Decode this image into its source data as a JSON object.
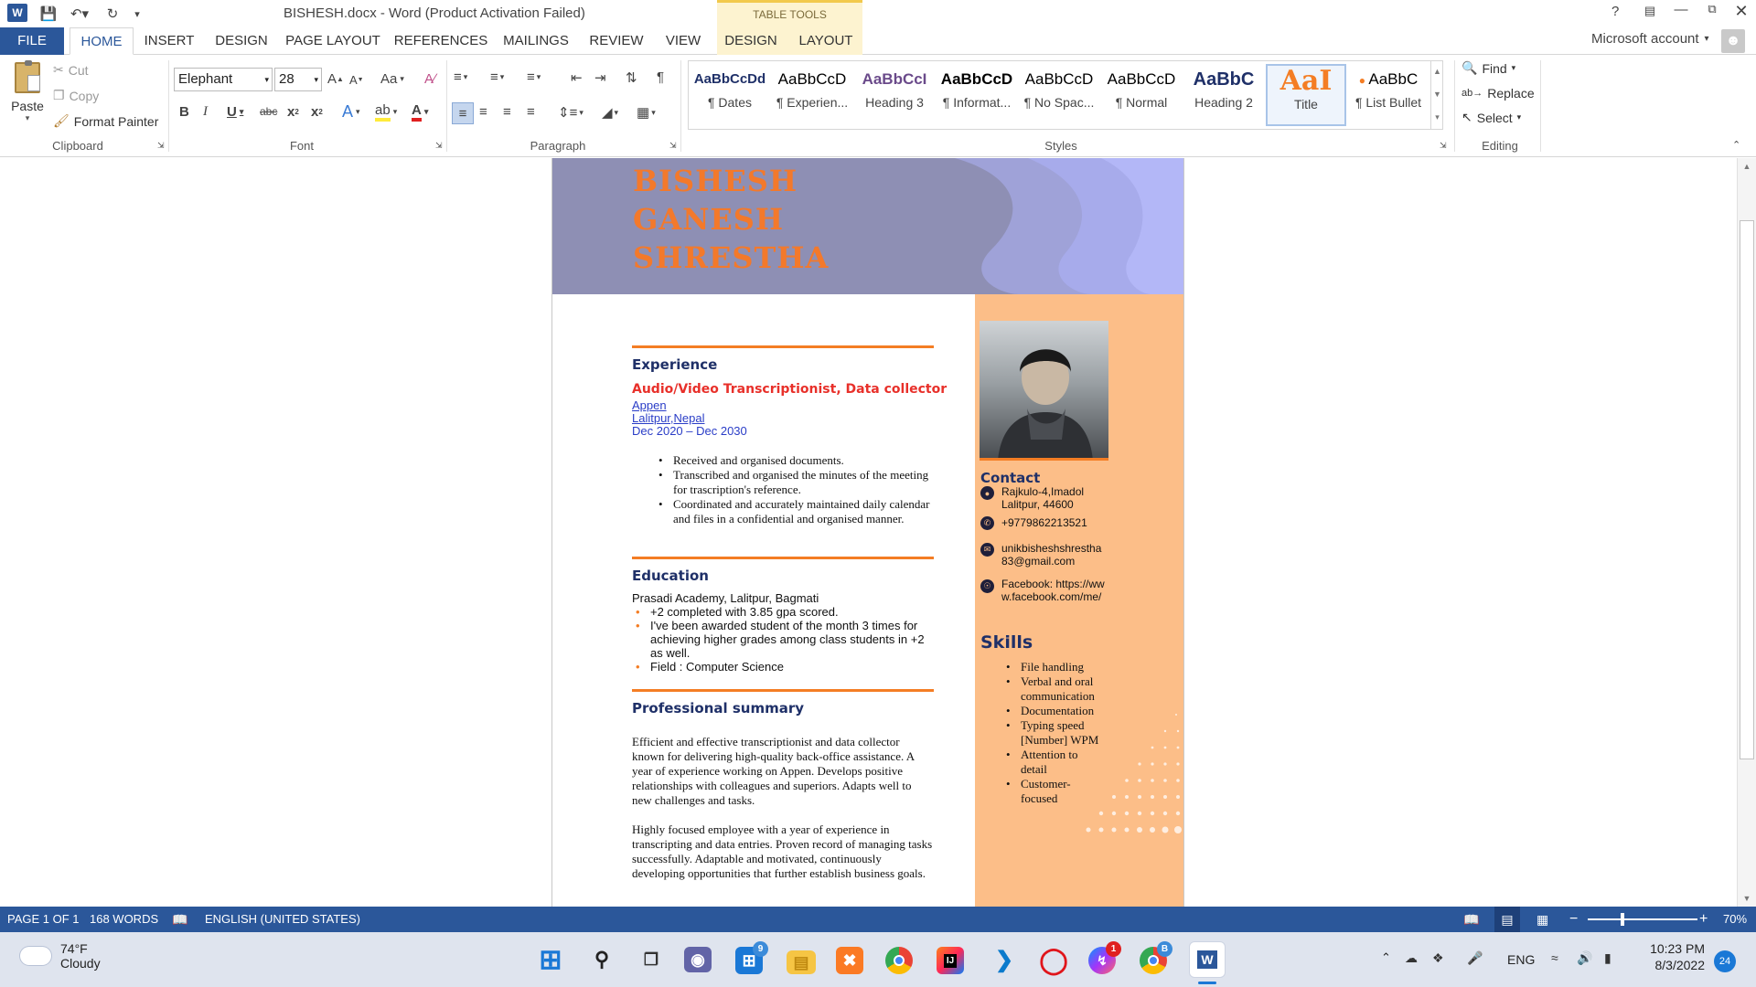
{
  "window": {
    "title": "BISHESH.docx - Word (Product Activation Failed)",
    "help": "?",
    "account": "Microsoft account"
  },
  "tabs": {
    "file": "FILE",
    "home": "HOME",
    "insert": "INSERT",
    "design": "DESIGN",
    "page_layout": "PAGE LAYOUT",
    "references": "REFERENCES",
    "mailings": "MAILINGS",
    "review": "REVIEW",
    "view": "VIEW",
    "table_tools": "TABLE TOOLS",
    "tt_design": "DESIGN",
    "tt_layout": "LAYOUT"
  },
  "clipboard": {
    "paste": "Paste",
    "cut": "Cut",
    "copy": "Copy",
    "format_painter": "Format Painter",
    "label": "Clipboard"
  },
  "font": {
    "family": "Elephant",
    "size": "28",
    "label": "Font",
    "change_case": "Aa"
  },
  "paragraph": {
    "label": "Paragraph"
  },
  "styles": {
    "label": "Styles",
    "items": [
      {
        "sample": "AaBbCcDd",
        "name": "¶ Dates"
      },
      {
        "sample": "AaBbCcD",
        "name": "¶ Experien..."
      },
      {
        "sample": "AaBbCcI",
        "name": "Heading 3"
      },
      {
        "sample": "AaBbCcD",
        "name": "¶ Informat..."
      },
      {
        "sample": "AaBbCcD",
        "name": "¶ No Spac..."
      },
      {
        "sample": "AaBbCcD",
        "name": "¶ Normal"
      },
      {
        "sample": "AaBbC",
        "name": "Heading 2"
      },
      {
        "sample": "AaI",
        "name": "Title"
      },
      {
        "sample": "AaBbC",
        "name": "¶ List Bullet"
      }
    ]
  },
  "editing": {
    "find": "Find",
    "replace": "Replace",
    "select": "Select",
    "label": "Editing"
  },
  "resume": {
    "name_lines": [
      "BISHESH",
      "GANESH",
      "SHRESTHA"
    ],
    "experience": {
      "heading": "Experience",
      "job_title": "Audio/Video Transcriptionist, Data collector",
      "company": "Appen",
      "location": "Lalitpur,Nepal",
      "dates": "Dec 2020 – Dec 2030",
      "bullets": [
        "Received and organised documents.",
        "Transcribed and organised the minutes of the meeting for trascription's reference.",
        "Coordinated and accurately maintained daily calendar and files in a confidential and organised manner."
      ]
    },
    "education": {
      "heading": "Education",
      "school": "Prasadi Academy, Lalitpur, Bagmati",
      "bullets": [
        "+2 completed with 3.85 gpa scored.",
        "I've been awarded student of the month 3 times for achieving higher grades among class students in +2 as well.",
        "Field : Computer Science"
      ]
    },
    "summary": {
      "heading": "Professional summary",
      "para1": "Efficient and effective transcriptionist and data collector known for delivering high-quality back-office assistance. A year of experience working on Appen. Develops positive relationships with colleagues and superiors. Adapts well to new challenges and tasks.",
      "para2": "Highly focused employee with a year of experience in transcripting and data entries. Proven record of managing tasks successfully. Adaptable and motivated, continuously developing opportunities that further establish business goals."
    },
    "contact": {
      "heading": "Contact",
      "address": "Rajkulo-4,Imadol Lalitpur, 44600",
      "phone": "+9779862213521",
      "email": "unikbisheshshrestha83@gmail.com",
      "website": "Facebook: https://www.facebook.com/me/"
    },
    "skills": {
      "heading": "Skills",
      "items": [
        "File handling",
        "Verbal and oral communication",
        "Documentation",
        "Typing speed [Number] WPM",
        "Attention to detail",
        "Customer-focused"
      ]
    }
  },
  "status": {
    "page": "PAGE 1 OF 1",
    "words": "168 WORDS",
    "language": "ENGLISH (UNITED STATES)",
    "zoom": "70%"
  },
  "taskbar": {
    "temp": "74°F",
    "weather": "Cloudy",
    "lang": "ENG",
    "time": "10:23 PM",
    "date": "8/3/2022",
    "notifications": "24",
    "badge_store": "9",
    "badge_messenger": "1",
    "badge_chrome": "B"
  },
  "colors": {
    "word_blue": "#2b579a",
    "accent_orange": "#f47d24",
    "side_orange": "#fcbe88",
    "header_purple": "#8e8fb4",
    "heading_navy": "#1f3068"
  }
}
